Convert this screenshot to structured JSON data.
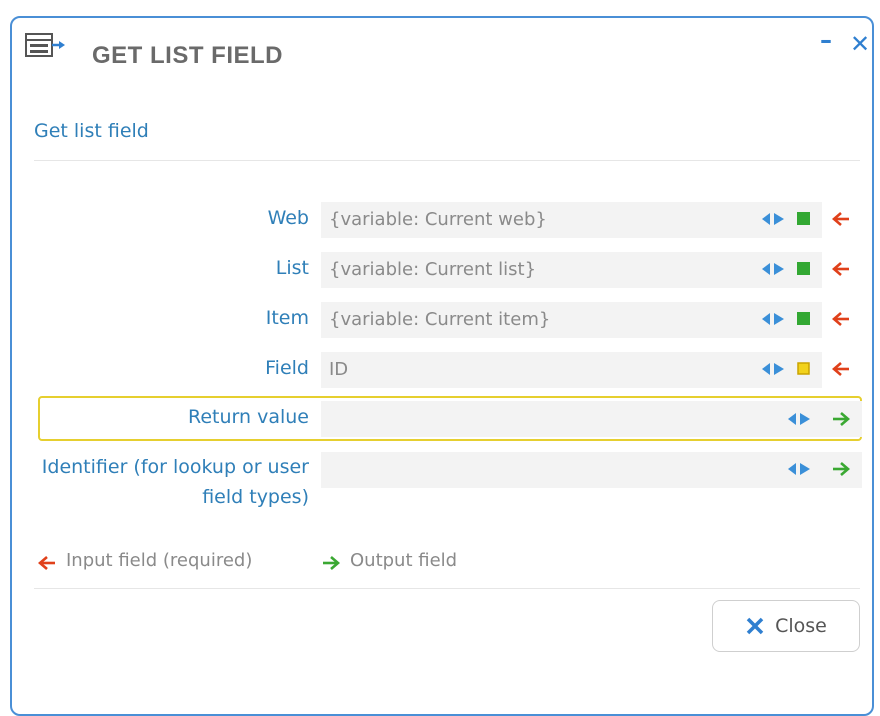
{
  "dialog": {
    "title": "GET LIST FIELD",
    "minimize_label": "–",
    "close_label": "✕"
  },
  "section": {
    "title": "Get list field"
  },
  "fields": [
    {
      "label": "Web",
      "value": "{variable: Current web}",
      "status": "set",
      "direction": "input"
    },
    {
      "label": "List",
      "value": "{variable: Current list}",
      "status": "set",
      "direction": "input"
    },
    {
      "label": "Item",
      "value": "{variable: Current item}",
      "status": "set",
      "direction": "input"
    },
    {
      "label": "Field",
      "value": "ID",
      "status": "warning",
      "direction": "input"
    },
    {
      "label": "Return value",
      "value": "",
      "status": "none",
      "direction": "output"
    },
    {
      "label": "Identifier (for lookup or user field types)",
      "value": "",
      "status": "none",
      "direction": "output"
    }
  ],
  "legend": {
    "input_text": "Input field (required)",
    "output_text": "Output field"
  },
  "buttons": {
    "close_label": "Close"
  },
  "colors": {
    "accent_blue": "#2f7fb8",
    "input_arrow": "#e0401a",
    "output_arrow": "#3aa832",
    "status_set": "#33a833",
    "status_warning": "#f2d21b",
    "highlight": "#e6cf2f"
  }
}
